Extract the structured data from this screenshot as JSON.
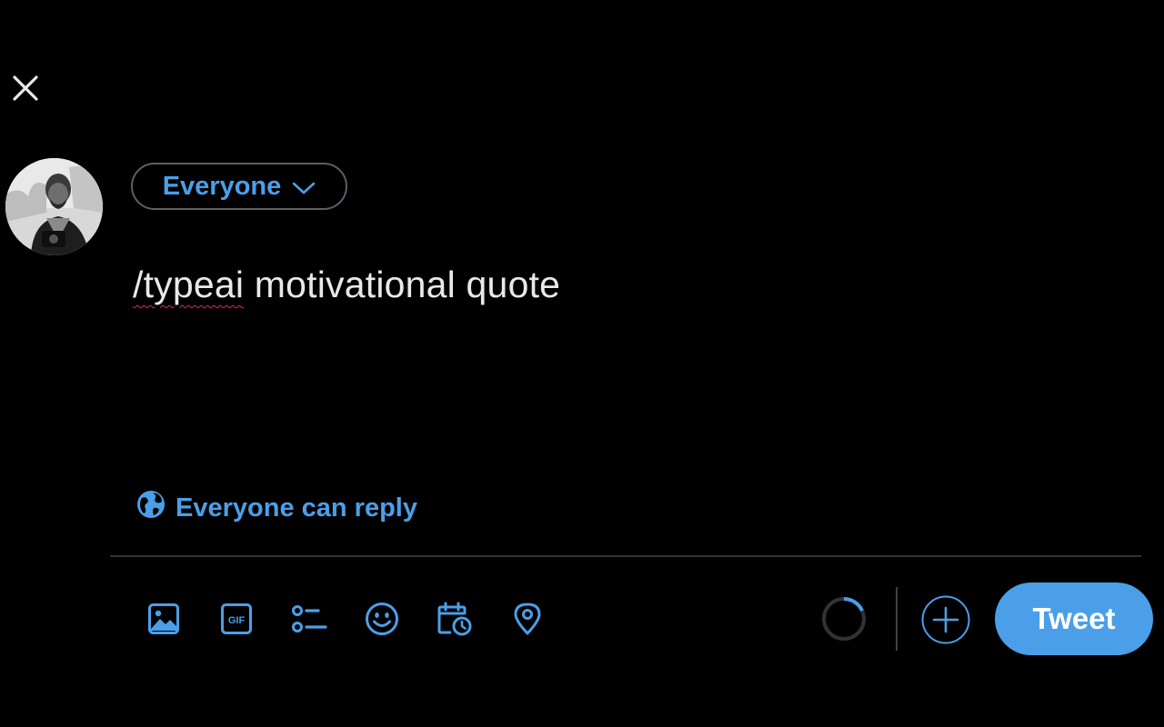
{
  "header": {
    "close_icon": "close-icon"
  },
  "composer": {
    "audience_label": "Everyone",
    "text_flagged": "/typeai",
    "text_rest": " motivational quote",
    "reply_setting_label": "Everyone can reply",
    "reply_setting_icon": "globe-icon"
  },
  "toolbar": {
    "items": [
      {
        "name": "media",
        "icon": "image-icon"
      },
      {
        "name": "gif",
        "icon": "gif-icon",
        "label": "GIF"
      },
      {
        "name": "poll",
        "icon": "poll-icon"
      },
      {
        "name": "emoji",
        "icon": "emoji-icon"
      },
      {
        "name": "schedule",
        "icon": "schedule-icon"
      },
      {
        "name": "location",
        "icon": "location-icon"
      }
    ],
    "tweet_label": "Tweet"
  },
  "colors": {
    "background": "#000000",
    "accent": "#4a9fe8",
    "text": "#e7e9ea",
    "border": "#2f3336"
  }
}
